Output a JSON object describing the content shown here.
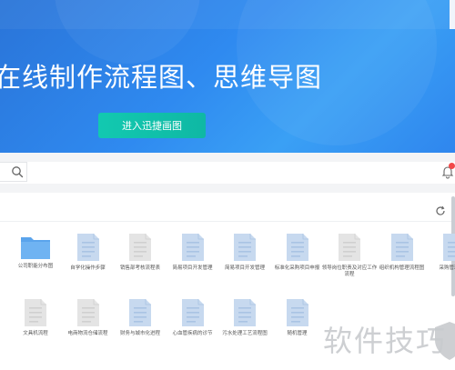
{
  "banner": {
    "title": "在线制作流程图、思维导图",
    "cta_label": "进入迅捷画图"
  },
  "colors": {
    "banner_blue": "#2f8af0",
    "cta_teal": "#12c9b0",
    "file_icon_blue": "#c7d9ef",
    "file_icon_gray": "#e4e4e4",
    "folder_blue": "#5aa4ec",
    "badge_red": "#f24848"
  },
  "icons": {
    "search": "search-icon",
    "bell": "bell-icon",
    "refresh": "refresh-icon",
    "folder": "folder-icon",
    "file": "file-icon"
  },
  "files_row1": [
    {
      "label": "公司职能分布图",
      "icon": "folder"
    },
    {
      "label": "自学化操作步骤",
      "icon": "file-blue"
    },
    {
      "label": "销售部考核流程表",
      "icon": "file-gray"
    },
    {
      "label": "简易项目开发管理",
      "icon": "file-blue"
    },
    {
      "label": "简易项目开发管理",
      "icon": "file-blue"
    },
    {
      "label": "标准化采购项目申报",
      "icon": "file-blue"
    },
    {
      "label": "领导岗位职责及对应工作流程",
      "icon": "file-gray"
    },
    {
      "label": "组织机构管理流程图",
      "icon": "file-blue"
    },
    {
      "label": "采购管理流程",
      "icon": "file-blue"
    }
  ],
  "files_row2": [
    {
      "label": "文具机流程",
      "icon": "file-gray"
    },
    {
      "label": "电商物流仓储流程",
      "icon": "file-gray"
    },
    {
      "label": "财务与城市化进程",
      "icon": "file-blue"
    },
    {
      "label": "心血管疾病的诊节",
      "icon": "file-blue"
    },
    {
      "label": "污水处理工艺流程图",
      "icon": "file-blue"
    },
    {
      "label": "随机管理",
      "icon": "file-blue"
    }
  ],
  "watermark": "软件技巧"
}
